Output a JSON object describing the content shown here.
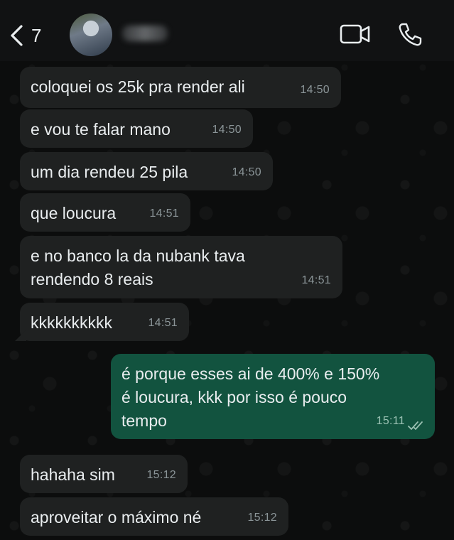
{
  "header": {
    "back_count": "7",
    "contact_name": "",
    "icons": {
      "back": "chevron-left-icon",
      "video": "video-camera-icon",
      "call": "phone-icon"
    }
  },
  "messages": [
    {
      "direction": "in",
      "text": "coloquei os 25k pra render ali",
      "time": "14:50"
    },
    {
      "direction": "in",
      "text": "e vou te falar mano",
      "time": "14:50"
    },
    {
      "direction": "in",
      "text": "um dia rendeu 25 pila",
      "time": "14:50"
    },
    {
      "direction": "in",
      "text": "que loucura",
      "time": "14:51"
    },
    {
      "direction": "in",
      "text": "e no banco la da nubank tava\nrendendo 8 reais",
      "time": "14:51"
    },
    {
      "direction": "in",
      "text": "kkkkkkkkkk",
      "time": "14:51"
    },
    {
      "direction": "out",
      "text": "é porque esses ai de 400% e 150%\né loucura, kkk por isso é pouco\ntempo",
      "time": "15:11",
      "status": "read"
    },
    {
      "direction": "in",
      "text": "hahaha sim",
      "time": "15:12"
    },
    {
      "direction": "in",
      "text": "aproveitar o máximo né",
      "time": "15:12"
    }
  ],
  "colors": {
    "incoming_bubble": "#1f2121",
    "outgoing_bubble": "#12533f",
    "header_bg": "#111213"
  }
}
